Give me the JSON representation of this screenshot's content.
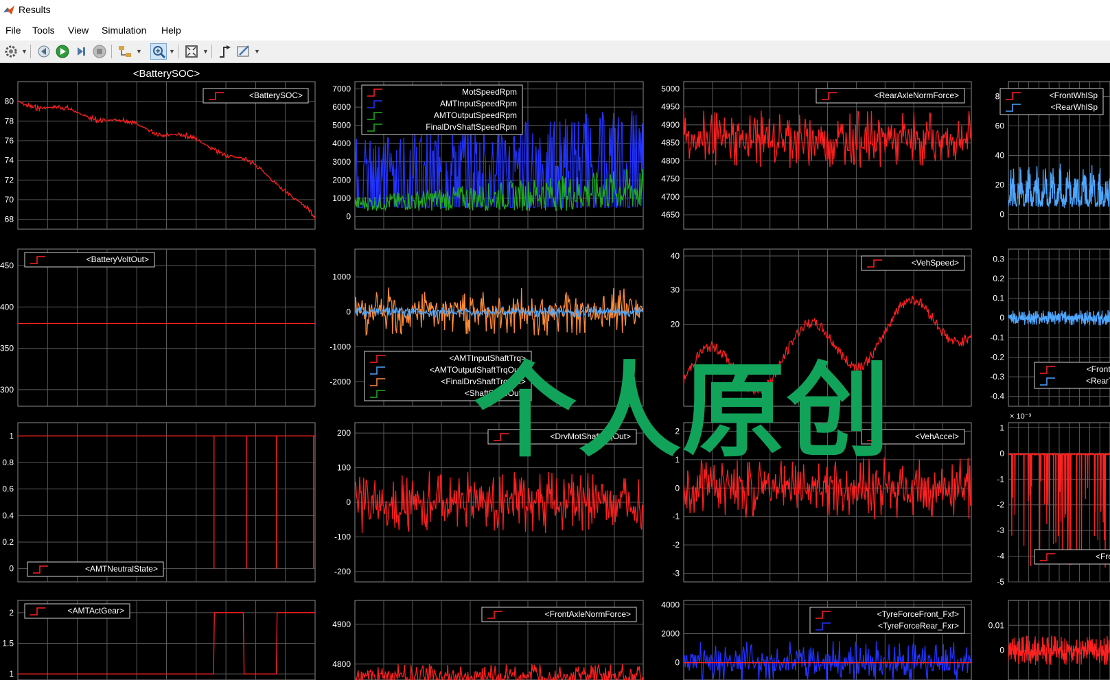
{
  "window": {
    "title": "Results"
  },
  "menu": [
    "File",
    "Tools",
    "View",
    "Simulation",
    "Help"
  ],
  "watermark": "个人原创",
  "colors": {
    "red": "#ff2020",
    "blue": "#2233ff",
    "green": "#22aa22",
    "lightblue": "#4da6ff",
    "orange": "#ff8c3a",
    "grid": "#5a5a5a"
  },
  "toolbar": [
    "settings-icon",
    "step-back-icon",
    "run-icon",
    "step-forward-icon",
    "stop-icon",
    "signal-selector-icon",
    "zoom-icon",
    "fit-to-view-icon",
    "trigger-icon",
    "style-icon"
  ],
  "plots": [
    {
      "id": "battery-soc",
      "title": "<BatterySOC>",
      "ylim": [
        67,
        82
      ],
      "yticks": [
        "80",
        "78",
        "76",
        "74",
        "72",
        "70",
        "68"
      ],
      "yvals": [
        80,
        78,
        76,
        74,
        72,
        70,
        68
      ],
      "legend": [
        {
          "name": "<BatterySOC>",
          "color": "red"
        }
      ],
      "legend_pos": "top-right",
      "series": [
        {
          "color": "red",
          "kind": "soc"
        }
      ]
    },
    {
      "id": "speeds",
      "title": "",
      "ylim": [
        -700,
        7400
      ],
      "yticks": [
        "7000",
        "6000",
        "5000",
        "4000",
        "3000",
        "2000",
        "1000",
        "0"
      ],
      "yvals": [
        7000,
        6000,
        5000,
        4000,
        3000,
        2000,
        1000,
        0
      ],
      "legend": [
        {
          "name": "MotSpeedRpm",
          "color": "red"
        },
        {
          "name": "AMTInputSpeedRpm",
          "color": "blue"
        },
        {
          "name": "AMTOutputSpeedRpm",
          "color": "green"
        },
        {
          "name": "FinalDrvShaftSpeedRpm",
          "color": "green"
        }
      ],
      "legend_pos": "top-left",
      "series": [
        {
          "color": "blue",
          "kind": "speed"
        },
        {
          "color": "green",
          "kind": "speed_low"
        }
      ]
    },
    {
      "id": "rear-axle-norm-force",
      "title": "",
      "ylim": [
        4610,
        5020
      ],
      "yticks": [
        "5000",
        "4950",
        "4900",
        "4850",
        "4800",
        "4750",
        "4700",
        "4650"
      ],
      "yvals": [
        5000,
        4950,
        4900,
        4850,
        4800,
        4750,
        4700,
        4650
      ],
      "legend": [
        {
          "name": "<RearAxleNormForce>",
          "color": "red"
        }
      ],
      "legend_pos": "top-right",
      "series": [
        {
          "color": "red",
          "kind": "noise",
          "base": 4860,
          "amp": 80
        }
      ]
    },
    {
      "id": "wheel-speed",
      "title": "",
      "ylim": [
        -10,
        90
      ],
      "yticks": [
        "80",
        "60",
        "40",
        "20",
        "0"
      ],
      "yvals": [
        80,
        60,
        40,
        20,
        0
      ],
      "legend": [
        {
          "name": "<FrontWhlSp",
          "color": "red"
        },
        {
          "name": "<RearWhlSp",
          "color": "lightblue"
        }
      ],
      "legend_pos": "top-right",
      "series": [
        {
          "color": "lightblue",
          "kind": "wheel"
        }
      ]
    },
    {
      "id": "battery-volt",
      "title": "",
      "ylim": [
        280,
        470
      ],
      "yticks": [
        "450",
        "400",
        "350",
        "300"
      ],
      "yvals": [
        450,
        400,
        350,
        300
      ],
      "legend": [
        {
          "name": "<BatteryVoltOut>",
          "color": "red"
        }
      ],
      "legend_pos": "top-left",
      "series": [
        {
          "color": "red",
          "kind": "const",
          "value": 380
        }
      ]
    },
    {
      "id": "shaft-torque",
      "title": "",
      "ylim": [
        -2700,
        1800
      ],
      "yticks": [
        "1000",
        "0",
        "-1000",
        "-2000"
      ],
      "yvals": [
        1000,
        0,
        -1000,
        -2000
      ],
      "legend": [
        {
          "name": "<AMTInputShaftTrq>",
          "color": "red"
        },
        {
          "name": "<AMTOutputShaftTrqOut>",
          "color": "lightblue"
        },
        {
          "name": "<FinalDrvShaftTrqOut>",
          "color": "orange"
        },
        {
          "name": "<ShaftStateOut>",
          "color": "green"
        }
      ],
      "legend_pos": "bottom-left",
      "series": [
        {
          "color": "orange",
          "kind": "noise",
          "base": 0,
          "amp": 700
        },
        {
          "color": "lightblue",
          "kind": "noise",
          "base": 0,
          "amp": 150
        }
      ]
    },
    {
      "id": "veh-speed",
      "title": "",
      "ylim": [
        -4,
        42
      ],
      "yticks": [
        "40",
        "30",
        "20"
      ],
      "yvals": [
        40,
        30,
        20
      ],
      "legend": [
        {
          "name": "<VehSpeed>",
          "color": "red"
        }
      ],
      "legend_pos": "top-right",
      "series": [
        {
          "color": "red",
          "kind": "vehspeed"
        }
      ]
    },
    {
      "id": "slip",
      "title": "",
      "ylim": [
        -0.45,
        0.35
      ],
      "yticks": [
        "0.3",
        "0.2",
        "0.1",
        "0",
        "-0.1",
        "-0.2",
        "-0.3",
        "-0.4"
      ],
      "yvals": [
        0.3,
        0.2,
        0.1,
        0,
        -0.1,
        -0.2,
        -0.3,
        -0.4
      ],
      "legend": [
        {
          "name": "<FrontTyreS",
          "color": "red"
        },
        {
          "name": "<RearTyreSl",
          "color": "lightblue"
        }
      ],
      "legend_pos": "bottom-right",
      "series": [
        {
          "color": "lightblue",
          "kind": "noise",
          "base": 0,
          "amp": 0.04
        }
      ]
    },
    {
      "id": "amt-neutral",
      "title": "",
      "ylim": [
        -0.1,
        1.1
      ],
      "yticks": [
        "1",
        "0.8",
        "0.6",
        "0.4",
        "0.2",
        "0"
      ],
      "yvals": [
        1,
        0.8,
        0.6,
        0.4,
        0.2,
        0
      ],
      "legend": [
        {
          "name": "<AMTNeutralState>",
          "color": "red"
        }
      ],
      "legend_pos": "bottom-left",
      "series": [
        {
          "color": "red",
          "kind": "neutral"
        }
      ]
    },
    {
      "id": "drv-mot-torque",
      "title": "",
      "ylim": [
        -230,
        230
      ],
      "yticks": [
        "200",
        "100",
        "0",
        "-100",
        "-200"
      ],
      "yvals": [
        200,
        100,
        0,
        -100,
        -200
      ],
      "legend": [
        {
          "name": "<DrvMotShaftTrqOut>",
          "color": "red"
        }
      ],
      "legend_pos": "top-right",
      "series": [
        {
          "color": "red",
          "kind": "noise",
          "base": 0,
          "amp": 90
        }
      ]
    },
    {
      "id": "veh-accel",
      "title": "",
      "ylim": [
        -3.3,
        2.3
      ],
      "yticks": [
        "2",
        "1",
        "0",
        "-1",
        "-2",
        "-3"
      ],
      "yvals": [
        2,
        1,
        0,
        -1,
        -2,
        -3
      ],
      "legend": [
        {
          "name": "<VehAccel>",
          "color": "red"
        }
      ],
      "legend_pos": "top-right",
      "series": [
        {
          "color": "red",
          "kind": "noise",
          "base": 0,
          "amp": 1.1
        }
      ]
    },
    {
      "id": "wheel-torque-small",
      "title": "",
      "exponent": "× 10⁻³",
      "ylim": [
        -5,
        1.2
      ],
      "yticks": [
        "1",
        "0",
        "-1",
        "-2",
        "-3",
        "-4",
        "-5"
      ],
      "yvals": [
        1,
        0,
        -1,
        -2,
        -3,
        -4,
        -5
      ],
      "legend": [
        {
          "name": "<FrontWh",
          "color": "red"
        }
      ],
      "legend_pos": "bottom-right",
      "series": [
        {
          "color": "red",
          "kind": "smallspike"
        }
      ]
    },
    {
      "id": "amt-gear",
      "title": "",
      "ylim": [
        0.9,
        2.2
      ],
      "yticks": [
        "2",
        "1.5",
        "1"
      ],
      "yvals": [
        2,
        1.5,
        1
      ],
      "legend": [
        {
          "name": "<AMTActGear>",
          "color": "red"
        }
      ],
      "legend_pos": "top-left",
      "series": [
        {
          "color": "red",
          "kind": "gear"
        }
      ]
    },
    {
      "id": "front-axle-norm-force",
      "title": "",
      "ylim": [
        4760,
        4960
      ],
      "yticks": [
        "4900",
        "4800"
      ],
      "yvals": [
        4900,
        4800
      ],
      "legend": [
        {
          "name": "<FrontAxleNormForce>",
          "color": "red"
        }
      ],
      "legend_pos": "top-right",
      "series": [
        {
          "color": "red",
          "kind": "noise",
          "base": 4770,
          "amp": 30
        }
      ]
    },
    {
      "id": "tyre-force",
      "title": "",
      "ylim": [
        -1200,
        4300
      ],
      "yticks": [
        "4000",
        "2000",
        "0"
      ],
      "yvals": [
        4000,
        2000,
        0
      ],
      "legend": [
        {
          "name": "<TyreForceFront_Fxf>",
          "color": "red"
        },
        {
          "name": "<TyreForceRear_Fxr>",
          "color": "blue"
        }
      ],
      "legend_pos": "top-right",
      "series": [
        {
          "color": "blue",
          "kind": "noise",
          "base": 0,
          "amp": 1500
        },
        {
          "color": "red",
          "kind": "const",
          "value": 0
        }
      ]
    },
    {
      "id": "small-right",
      "title": "",
      "ylim": [
        -0.012,
        0.02
      ],
      "yticks": [
        "0.01",
        "0"
      ],
      "yvals": [
        0.01,
        0
      ],
      "legend": [],
      "legend_pos": "none",
      "series": [
        {
          "color": "red",
          "kind": "noise",
          "base": 0,
          "amp": 0.006
        }
      ]
    }
  ]
}
